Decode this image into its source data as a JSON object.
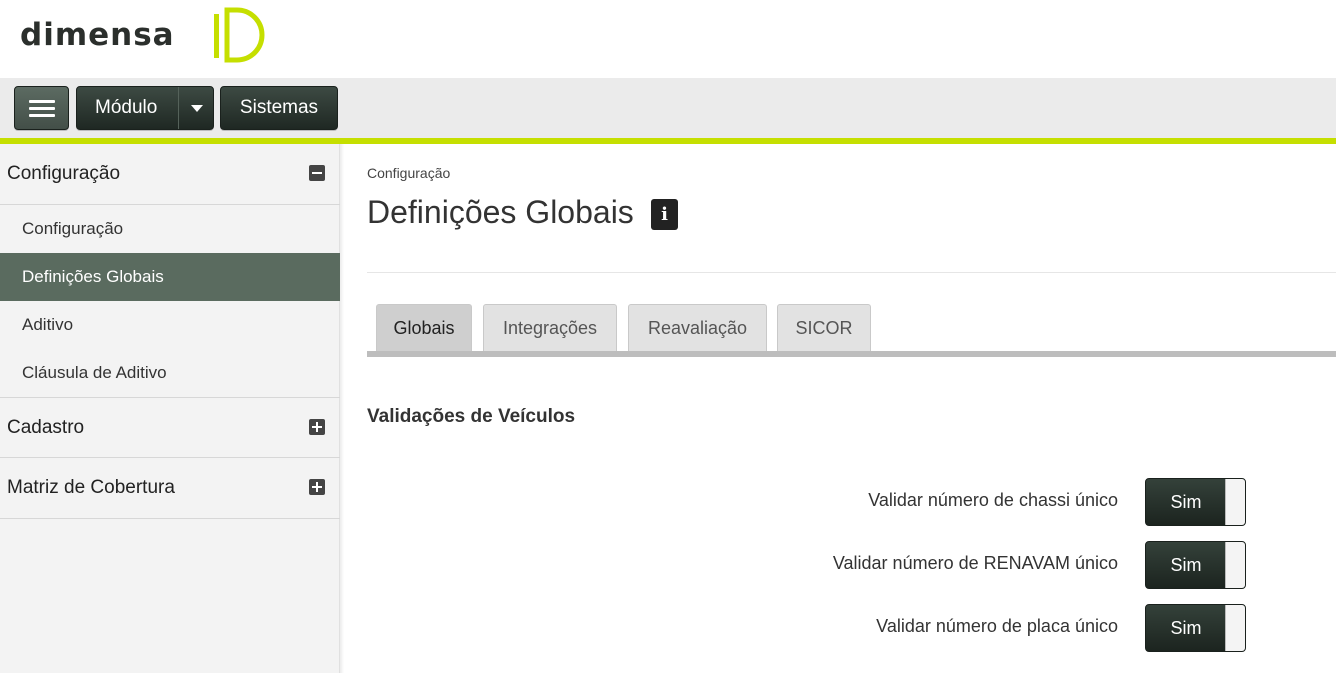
{
  "header": {
    "logo_text": "DIMENSA"
  },
  "toolbar": {
    "menu_icon": "hamburger-icon",
    "modulo_label": "Módulo",
    "sistemas_label": "Sistemas"
  },
  "sidebar": {
    "sections": [
      {
        "label": "Configuração",
        "toggle": "minus-icon",
        "items": [
          {
            "label": "Configuração",
            "active": false
          },
          {
            "label": "Definições Globais",
            "active": true
          },
          {
            "label": "Aditivo",
            "active": false
          },
          {
            "label": "Cláusula de Aditivo",
            "active": false
          }
        ]
      },
      {
        "label": "Cadastro",
        "toggle": "plus-icon"
      },
      {
        "label": "Matriz de Cobertura",
        "toggle": "plus-icon"
      }
    ]
  },
  "main": {
    "breadcrumb": "Configuração",
    "title": "Definições Globais",
    "info_icon": "i",
    "tabs": [
      {
        "label": "Globais",
        "active": true
      },
      {
        "label": "Integrações",
        "active": false
      },
      {
        "label": "Reavaliação",
        "active": false
      },
      {
        "label": "SICOR",
        "active": false
      }
    ],
    "section_title": "Validações de Veículos",
    "settings": [
      {
        "label": "Validar número de chassi único",
        "value": "Sim"
      },
      {
        "label": "Validar número de RENAVAM único",
        "value": "Sim"
      },
      {
        "label": "Validar número de placa único",
        "value": "Sim"
      }
    ]
  },
  "colors": {
    "accent_line": "#c5df00",
    "active_menu": "#5a6b5f",
    "dark_button": "#2a3530"
  }
}
